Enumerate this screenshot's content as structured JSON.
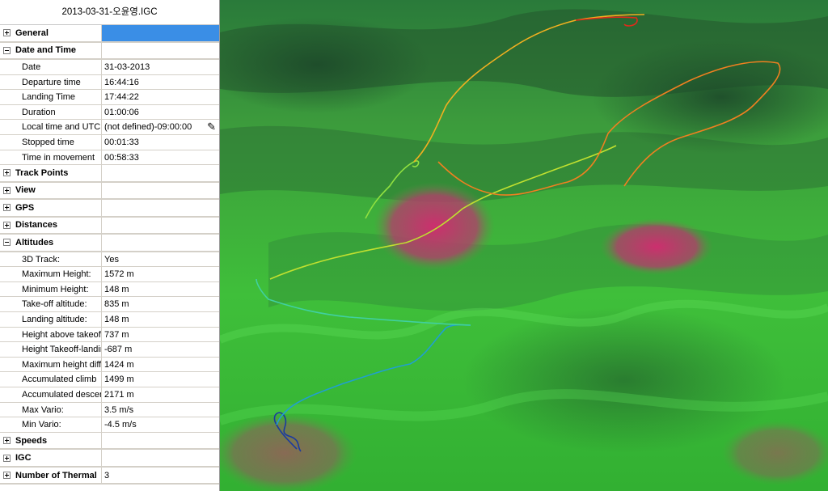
{
  "window": {
    "title": "2013-03-31-오윤영.IGC"
  },
  "sections": {
    "general": {
      "label": "General"
    },
    "date_time": {
      "label": "Date and Time",
      "rows": [
        {
          "key": "Date",
          "value": "31-03-2013"
        },
        {
          "key": "Departure time",
          "value": "16:44:16"
        },
        {
          "key": "Landing Time",
          "value": "17:44:22"
        },
        {
          "key": "Duration",
          "value": "01:00:06"
        },
        {
          "key": "Local time and UTC d",
          "value": "(not defined)-09:00:00"
        },
        {
          "key": "Stopped time",
          "value": "00:01:33"
        },
        {
          "key": "Time in movement",
          "value": "00:58:33"
        }
      ]
    },
    "track_points": {
      "label": "Track Points"
    },
    "view": {
      "label": "View"
    },
    "gps": {
      "label": "GPS"
    },
    "distances": {
      "label": "Distances"
    },
    "altitudes": {
      "label": "Altitudes",
      "rows": [
        {
          "key": "3D Track:",
          "value": "Yes"
        },
        {
          "key": "Maximum Height:",
          "value": "1572 m"
        },
        {
          "key": "Minimum Height:",
          "value": "148 m"
        },
        {
          "key": "Take-off altitude:",
          "value": "835 m"
        },
        {
          "key": "Landing altitude:",
          "value": "148 m"
        },
        {
          "key": "Height above takeoff",
          "value": "737 m"
        },
        {
          "key": "Height Takeoff-landir",
          "value": "-687 m"
        },
        {
          "key": "Maximum height differ",
          "value": "1424 m"
        },
        {
          "key": "Accumulated climb",
          "value": "1499 m"
        },
        {
          "key": "Accumulated descen",
          "value": "2171 m"
        },
        {
          "key": "Max Vario:",
          "value": "3.5 m/s"
        },
        {
          "key": "Min Vario:",
          "value": "-4.5 m/s"
        }
      ]
    },
    "speeds": {
      "label": "Speeds"
    },
    "igc": {
      "label": "IGC"
    },
    "thermals": {
      "label": "Number of Thermal",
      "value": "3"
    }
  },
  "colors": {
    "selection": "#3a8ee6",
    "terrain_green": "#33b533",
    "terrain_pink": "#c03a78",
    "track_start": "#1a3aa0",
    "track_end": "#e01a1a"
  },
  "icons": {
    "pencil": "pencil-icon",
    "expand": "plus-icon",
    "collapse": "minus-icon"
  }
}
